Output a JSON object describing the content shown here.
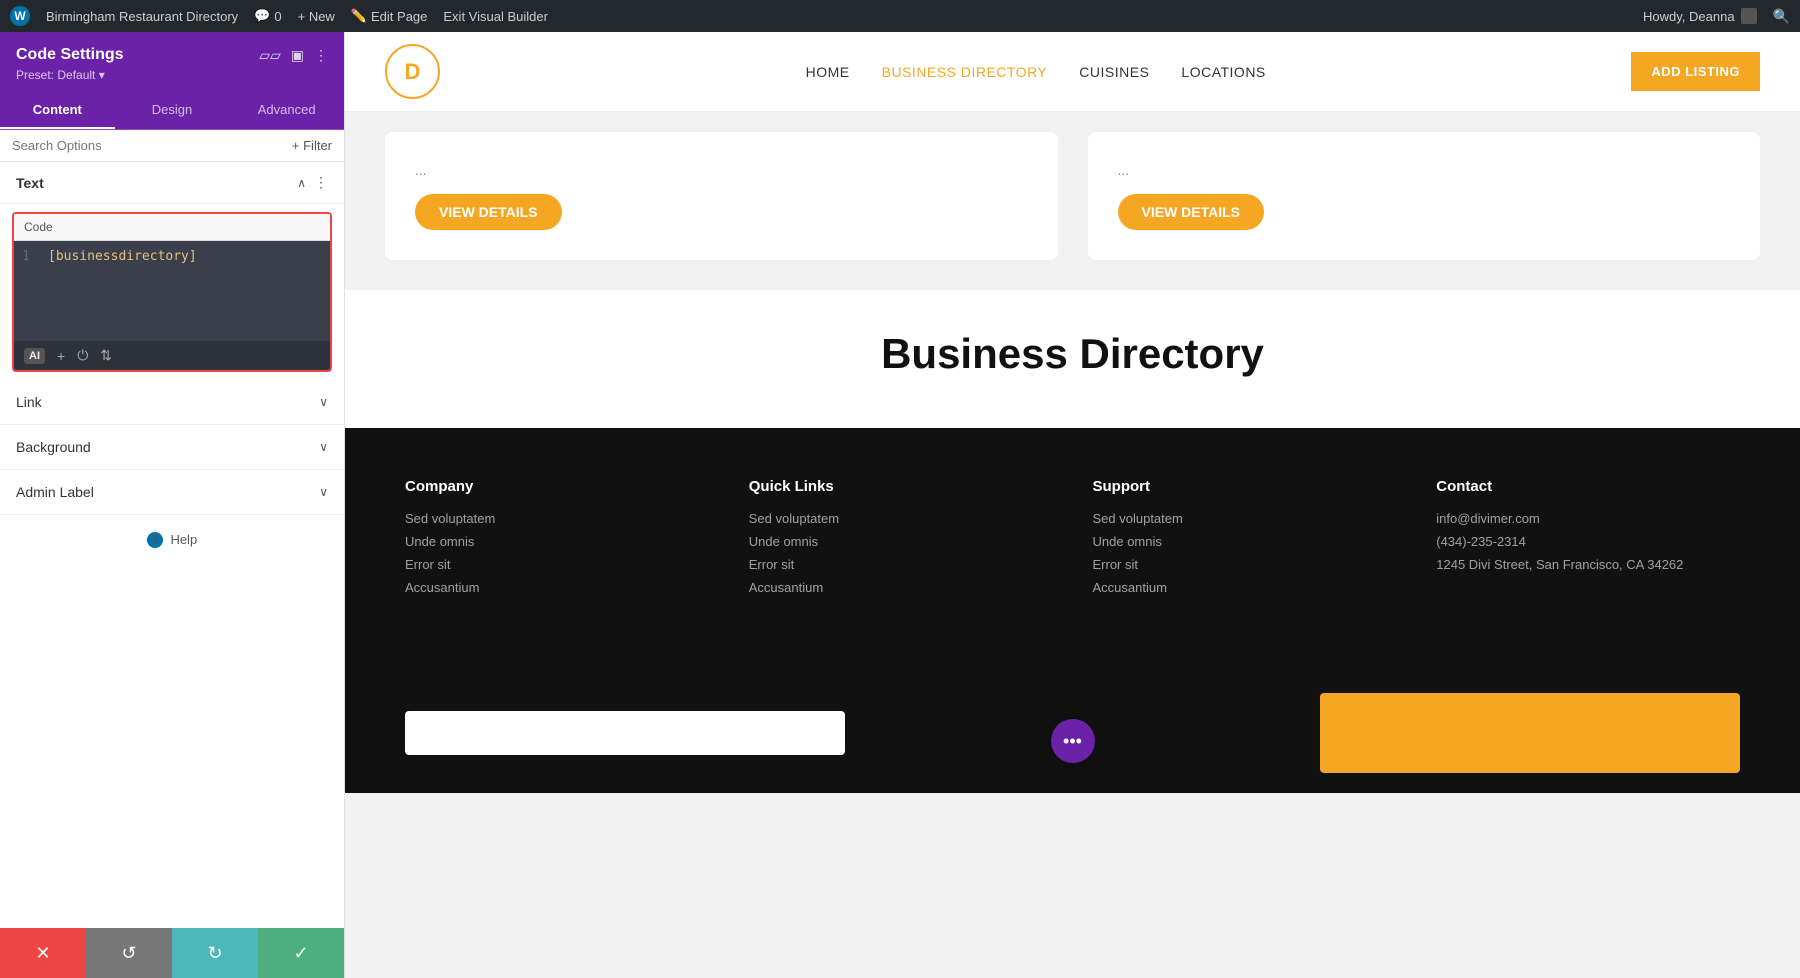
{
  "adminBar": {
    "wpIcon": "W",
    "siteName": "Birmingham Restaurant Directory",
    "comments": "0",
    "newLabel": "+ New",
    "editPage": "Edit Page",
    "exitBuilder": "Exit Visual Builder",
    "howdy": "Howdy, Deanna"
  },
  "sidebar": {
    "title": "Code Settings",
    "preset": "Preset: Default ▾",
    "tabs": [
      "Content",
      "Design",
      "Advanced"
    ],
    "activeTab": "Content",
    "searchPlaceholder": "Search Options",
    "filterLabel": "+ Filter",
    "sections": {
      "text": {
        "label": "Text",
        "code": {
          "label": "Code",
          "lineNumber": "1",
          "content": "[businessdirectory]"
        }
      },
      "link": {
        "label": "Link"
      },
      "background": {
        "label": "Background"
      },
      "adminLabel": {
        "label": "Admin Label"
      }
    },
    "help": "Help"
  },
  "bottomBar": {
    "cancel": "✕",
    "undo": "↺",
    "redo": "↻",
    "save": "✓"
  },
  "siteHeader": {
    "logo": "D",
    "nav": [
      "HOME",
      "BUSINESS DIRECTORY",
      "CUISINES",
      "LOCATIONS"
    ],
    "activeNav": "BUSINESS DIRECTORY",
    "addListingBtn": "ADD LISTING"
  },
  "cards": [
    {
      "viewBtn": "VIEW DETAILS"
    },
    {
      "viewBtn": "VIEW DETAILS"
    }
  ],
  "businessDirectory": {
    "title": "Business Directory"
  },
  "footer": {
    "columns": [
      {
        "title": "Company",
        "links": [
          "Sed voluptatem",
          "Unde omnis",
          "Error sit",
          "Accusantium"
        ]
      },
      {
        "title": "Quick Links",
        "links": [
          "Sed voluptatem",
          "Unde omnis",
          "Error sit",
          "Accusantium"
        ]
      },
      {
        "title": "Support",
        "links": [
          "Sed voluptatem",
          "Unde omnis",
          "Error sit",
          "Accusantium"
        ]
      },
      {
        "title": "Contact",
        "links": [
          "info@divimer.com",
          "(434)-235-2314",
          "1245 Divi Street, San Francisco, CA 34262"
        ]
      }
    ]
  },
  "icons": {
    "ai": "AI",
    "plus": "+",
    "power": "⏻",
    "move": "⇅",
    "help": "?",
    "chevronDown": "∨",
    "ellipsis": "•••",
    "minimize": "▱▱",
    "split": "▣",
    "moreVert": "⋮"
  },
  "colors": {
    "purple": "#6b21a8",
    "orange": "#f5a623",
    "red": "#e44444",
    "teal": "#4db8b8",
    "green": "#4caf7d",
    "dark": "#111111",
    "codeEditor": "#3a3f4b"
  }
}
